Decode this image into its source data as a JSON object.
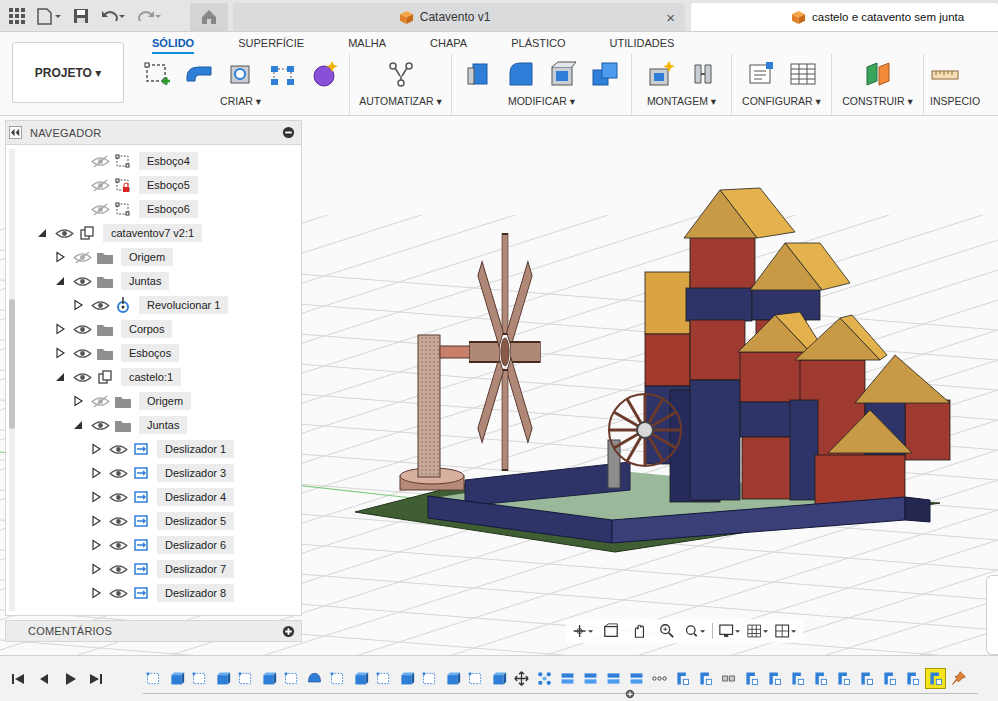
{
  "window": {
    "home_tab": {
      "selected": false
    },
    "file_tabs": [
      {
        "label": "Catavento v1",
        "close": "×",
        "selected": false
      },
      {
        "label": "castelo e catavento sem junta",
        "close": "",
        "selected": true
      }
    ]
  },
  "toolbar": {
    "project_button": "PROJETO ▾",
    "tabs": [
      {
        "label": "SÓLIDO",
        "selected": true
      },
      {
        "label": "SUPERFÍCIE",
        "selected": false
      },
      {
        "label": "MALHA",
        "selected": false
      },
      {
        "label": "CHAPA",
        "selected": false
      },
      {
        "label": "PLÁSTICO",
        "selected": false
      },
      {
        "label": "UTILIDADES",
        "selected": false
      }
    ],
    "groups": [
      {
        "label": "CRIAR ▾",
        "icons": [
          "sketch",
          "extrude",
          "hole",
          "pattern",
          "form"
        ]
      },
      {
        "label": "AUTOMATIZAR ▾",
        "icons": [
          "automate"
        ]
      },
      {
        "label": "MODIFICAR ▾",
        "icons": [
          "press-pull",
          "fillet",
          "shell",
          "combine"
        ]
      },
      {
        "label": "MONTAGEM ▾",
        "icons": [
          "new-component",
          "joint"
        ]
      },
      {
        "label": "CONFIGURAR ▾",
        "icons": [
          "parameters",
          "table"
        ]
      },
      {
        "label": "CONSTRUIR ▾",
        "icons": [
          "plane"
        ]
      },
      {
        "label": "INSPECIO",
        "icons": [
          "measure"
        ]
      }
    ]
  },
  "navigator": {
    "title": "NAVEGADOR",
    "items": [
      {
        "label": "Esboço4",
        "level": 2,
        "kind": "sketch",
        "visible": false,
        "expandable": false,
        "expanded": false
      },
      {
        "label": "Esboço5",
        "level": 2,
        "kind": "sketch-locked",
        "visible": false,
        "expandable": false,
        "expanded": false
      },
      {
        "label": "Esboço6",
        "level": 2,
        "kind": "sketch",
        "visible": false,
        "expandable": false,
        "expanded": false
      },
      {
        "label": "cataventov7 v2:1",
        "level": 0,
        "kind": "component",
        "visible": true,
        "expandable": true,
        "expanded": true
      },
      {
        "label": "Origem",
        "level": 1,
        "kind": "folder",
        "visible": false,
        "expandable": true,
        "expanded": false
      },
      {
        "label": "Juntas",
        "level": 1,
        "kind": "folder",
        "visible": true,
        "expandable": true,
        "expanded": true
      },
      {
        "label": "Revolucionar 1",
        "level": 2,
        "kind": "joint-revolute",
        "visible": true,
        "expandable": true,
        "expanded": false
      },
      {
        "label": "Corpos",
        "level": 1,
        "kind": "folder",
        "visible": true,
        "expandable": true,
        "expanded": false
      },
      {
        "label": "Esboços",
        "level": 1,
        "kind": "folder",
        "visible": true,
        "expandable": true,
        "expanded": false
      },
      {
        "label": "castelo:1",
        "level": 1,
        "kind": "component",
        "visible": true,
        "expandable": true,
        "expanded": true
      },
      {
        "label": "Origem",
        "level": 2,
        "kind": "folder",
        "visible": false,
        "expandable": true,
        "expanded": false
      },
      {
        "label": "Juntas",
        "level": 2,
        "kind": "folder",
        "visible": true,
        "expandable": true,
        "expanded": true
      },
      {
        "label": "Deslizador 1",
        "level": 3,
        "kind": "joint-slider",
        "visible": true,
        "expandable": true,
        "expanded": false
      },
      {
        "label": "Deslizador 3",
        "level": 3,
        "kind": "joint-slider",
        "visible": true,
        "expandable": true,
        "expanded": false
      },
      {
        "label": "Deslizador 4",
        "level": 3,
        "kind": "joint-slider",
        "visible": true,
        "expandable": true,
        "expanded": false
      },
      {
        "label": "Deslizador 5",
        "level": 3,
        "kind": "joint-slider",
        "visible": true,
        "expandable": true,
        "expanded": false
      },
      {
        "label": "Deslizador 6",
        "level": 3,
        "kind": "joint-slider",
        "visible": true,
        "expandable": true,
        "expanded": false
      },
      {
        "label": "Deslizador 7",
        "level": 3,
        "kind": "joint-slider",
        "visible": true,
        "expandable": true,
        "expanded": false
      },
      {
        "label": "Deslizador 8",
        "level": 3,
        "kind": "joint-slider",
        "visible": true,
        "expandable": true,
        "expanded": false
      }
    ]
  },
  "comments": {
    "title": "COMENTÁRIOS"
  },
  "timeline": {
    "items": [
      {
        "kind": "sketch",
        "selected": false
      },
      {
        "kind": "extrude",
        "selected": false
      },
      {
        "kind": "sketch",
        "selected": false
      },
      {
        "kind": "extrude",
        "selected": false
      },
      {
        "kind": "sketch",
        "selected": false
      },
      {
        "kind": "extrude",
        "selected": false
      },
      {
        "kind": "sketch",
        "selected": false
      },
      {
        "kind": "revolve",
        "selected": false
      },
      {
        "kind": "sketch",
        "selected": false
      },
      {
        "kind": "extrude",
        "selected": false
      },
      {
        "kind": "sketch",
        "selected": false
      },
      {
        "kind": "extrude",
        "selected": false
      },
      {
        "kind": "sketch",
        "selected": false
      },
      {
        "kind": "extrude",
        "selected": false
      },
      {
        "kind": "sketch",
        "selected": false
      },
      {
        "kind": "extrude",
        "selected": false
      },
      {
        "kind": "move",
        "selected": false
      },
      {
        "kind": "pattern",
        "selected": false
      },
      {
        "kind": "combine",
        "selected": false
      },
      {
        "kind": "combine",
        "selected": false
      },
      {
        "kind": "combine",
        "selected": false
      },
      {
        "kind": "combine",
        "selected": false
      },
      {
        "kind": "group",
        "selected": false
      },
      {
        "kind": "joint",
        "selected": false
      },
      {
        "kind": "joint",
        "selected": false
      },
      {
        "kind": "rigid",
        "selected": false
      },
      {
        "kind": "joint",
        "selected": false
      },
      {
        "kind": "joint",
        "selected": false
      },
      {
        "kind": "joint",
        "selected": false
      },
      {
        "kind": "joint",
        "selected": false
      },
      {
        "kind": "joint",
        "selected": false
      },
      {
        "kind": "joint",
        "selected": false
      },
      {
        "kind": "joint",
        "selected": false
      },
      {
        "kind": "joint",
        "selected": false
      },
      {
        "kind": "joint",
        "selected": true
      },
      {
        "kind": "pin",
        "selected": false
      }
    ]
  }
}
